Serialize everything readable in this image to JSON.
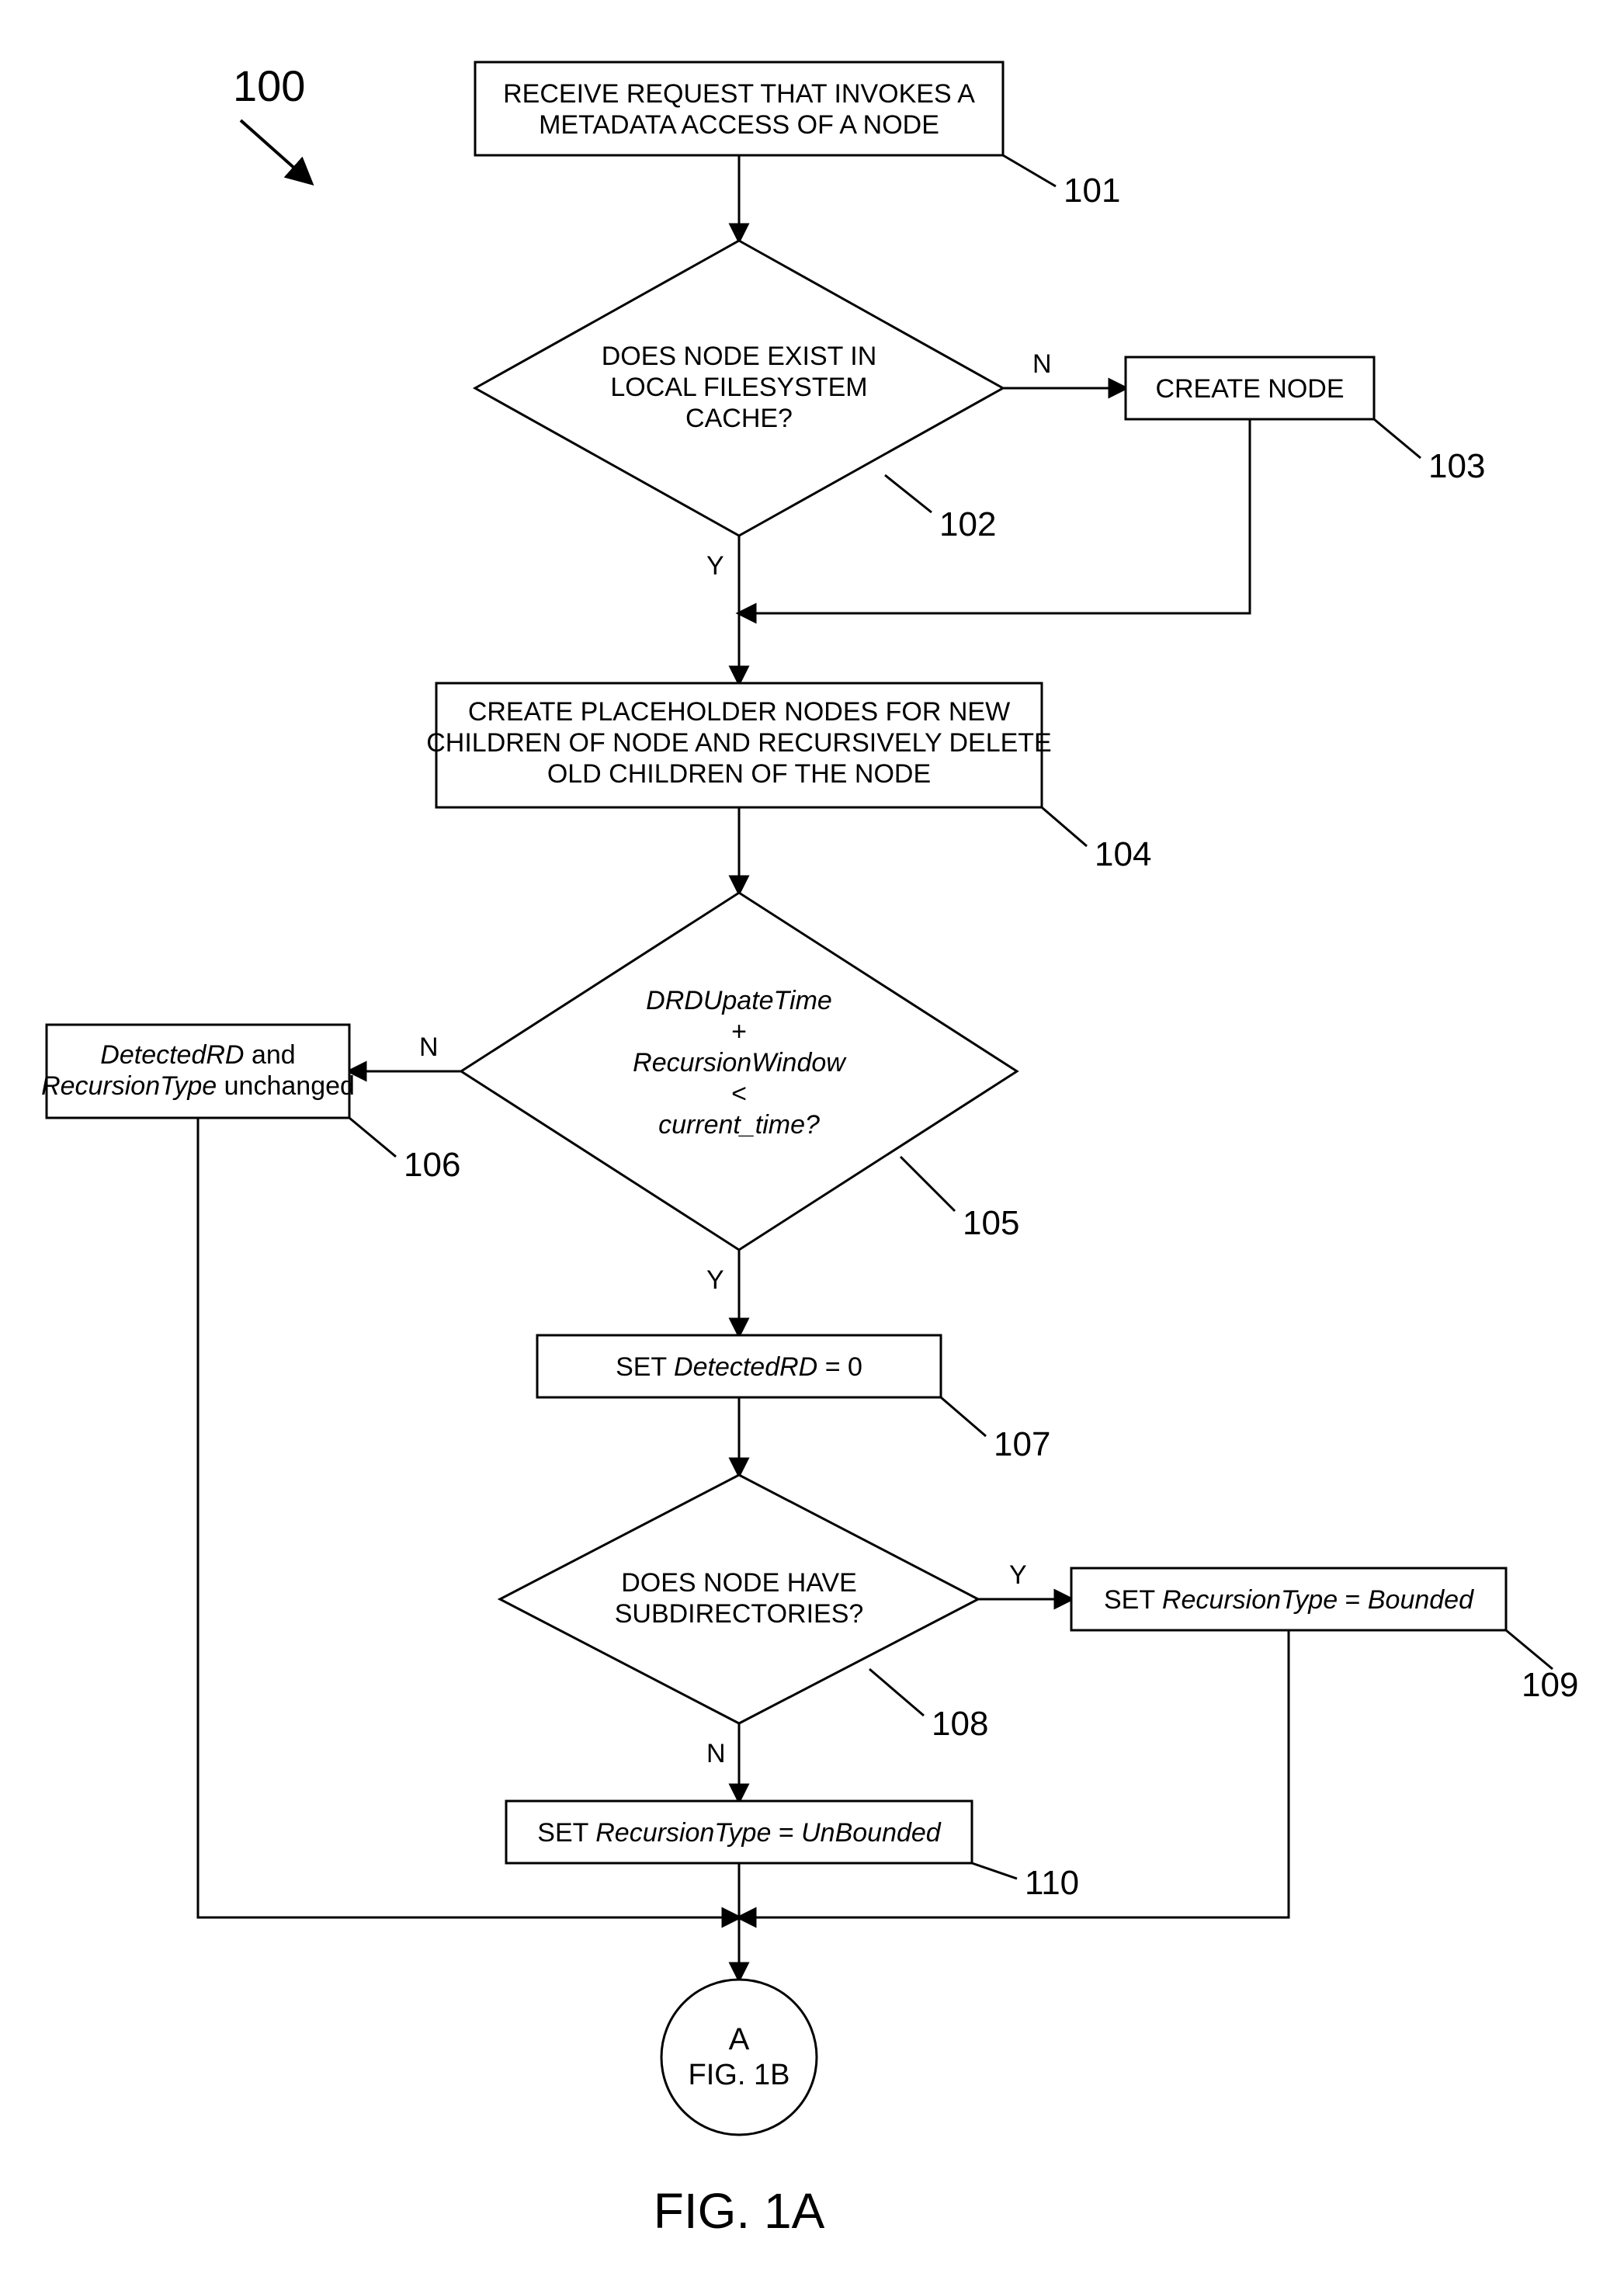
{
  "figure_number_label": "100",
  "figure_caption": "FIG. 1A",
  "nodes": {
    "101": {
      "text_lines": [
        "RECEIVE REQUEST THAT INVOKES A",
        "METADATA ACCESS OF A NODE"
      ],
      "ref": "101"
    },
    "102": {
      "text_lines": [
        "DOES NODE EXIST IN",
        "LOCAL FILESYSTEM",
        "CACHE?"
      ],
      "ref": "102"
    },
    "103": {
      "text_lines": [
        "CREATE NODE"
      ],
      "ref": "103"
    },
    "104": {
      "text_lines": [
        "CREATE PLACEHOLDER NODES FOR NEW",
        "CHILDREN OF NODE AND RECURSIVELY DELETE",
        "OLD CHILDREN OF THE  NODE"
      ],
      "ref": "104"
    },
    "105": {
      "text_lines": [
        "DRDUpateTime",
        "+",
        "RecursionWindow",
        "<",
        "current_time?"
      ],
      "ref": "105"
    },
    "106": {
      "text_line1_it1": "DetectedRD",
      "text_line1_plain": " and",
      "text_line2_it": "RecursionType",
      "text_line2_plain": " unchanged",
      "ref": "106"
    },
    "107": {
      "prefix": "SET ",
      "it": "DetectedRD",
      "suffix": " = 0",
      "ref": "107"
    },
    "108": {
      "text_lines": [
        "DOES NODE HAVE",
        "SUBDIRECTORIES?"
      ],
      "ref": "108"
    },
    "109": {
      "prefix": "SET ",
      "it1": "RecursionType",
      "mid": " = ",
      "it2": "Bounded",
      "ref": "109"
    },
    "110": {
      "prefix": "SET ",
      "it1": "RecursionType",
      "mid": " = ",
      "it2": "UnBounded",
      "ref": "110"
    },
    "connector": {
      "letter": "A",
      "caption": "FIG. 1B"
    }
  },
  "edges": {
    "yes": "Y",
    "no": "N"
  }
}
